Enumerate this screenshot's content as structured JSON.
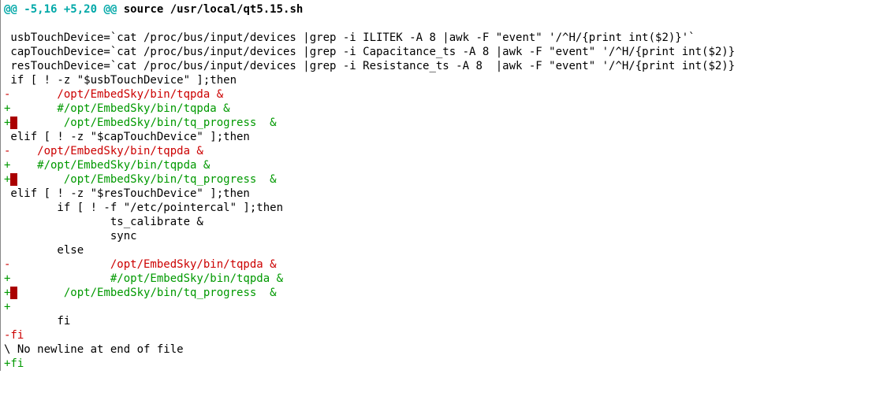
{
  "hunk": {
    "at1": "@@ ",
    "range": "-5,16 +5,20",
    "at2": " @@",
    "file": " source /usr/local/qt5.15.sh"
  },
  "lines": {
    "blank": " ",
    "l1": " usbTouchDevice=`cat /proc/bus/input/devices |grep -i ILITEK -A 8 |awk -F \"event\" '/^H/{print int($2)}'`",
    "l2": " capTouchDevice=`cat /proc/bus/input/devices |grep -i Capacitance_ts -A 8 |awk -F \"event\" '/^H/{print int($2)}",
    "l3": " resTouchDevice=`cat /proc/bus/input/devices |grep -i Resistance_ts -A 8  |awk -F \"event\" '/^H/{print int($2)}",
    "l4": " if [ ! -z \"$usbTouchDevice\" ];then",
    "d1": "-       /opt/EmbedSky/bin/tqpda &",
    "a1": "+       #/opt/EmbedSky/bin/tqpda &",
    "a2a": "+",
    "a2b": "       /opt/EmbedSky/bin/tq_progress  &",
    "l5": " elif [ ! -z \"$capTouchDevice\" ];then",
    "d2": "-    /opt/EmbedSky/bin/tqpda &",
    "a3": "+    #/opt/EmbedSky/bin/tqpda &",
    "a4a": "+",
    "a4b": "       /opt/EmbedSky/bin/tq_progress  &",
    "l6": " elif [ ! -z \"$resTouchDevice\" ];then",
    "l7": "        if [ ! -f \"/etc/pointercal\" ];then",
    "l8": "                ts_calibrate &",
    "l9": "                sync",
    "l10": "        else",
    "d3": "-               /opt/EmbedSky/bin/tqpda &",
    "a5": "+               #/opt/EmbedSky/bin/tqpda &",
    "a6a": "+",
    "a6b": "       /opt/EmbedSky/bin/tq_progress  &",
    "a7": "+",
    "l11": "        fi",
    "d4": "-fi",
    "l12": "\\ No newline at end of file",
    "a8": "+fi"
  },
  "hlpad": " "
}
